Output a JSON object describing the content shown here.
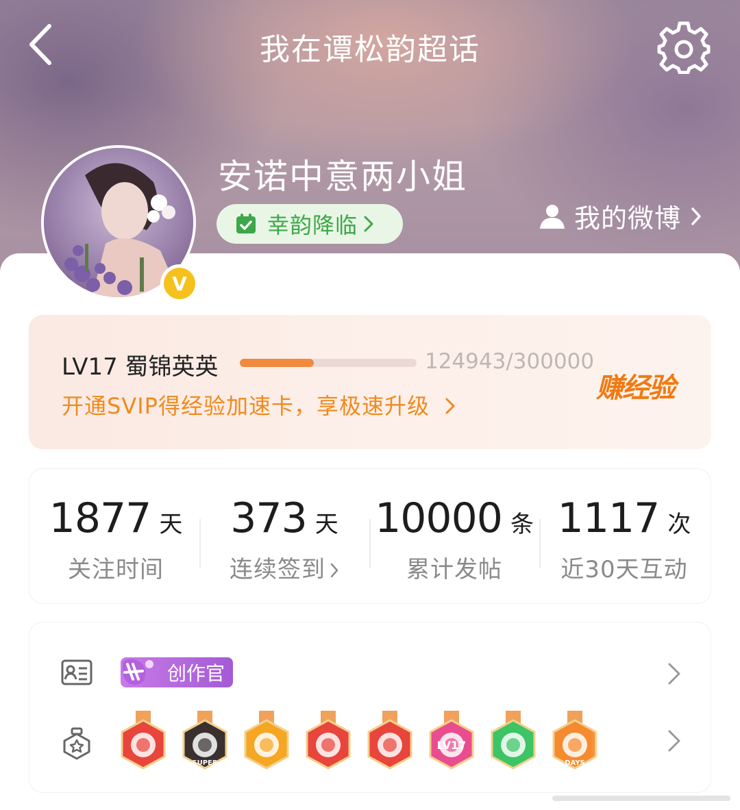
{
  "header": {
    "title": "我在谭松韵超话",
    "back_icon": "chevron-left-icon",
    "settings_icon": "gear-icon"
  },
  "profile": {
    "username": "安诺中意两小姐",
    "verified_badge": "V",
    "fortune_label": "幸韵降临",
    "fortune_icon": "calendar-check-icon",
    "my_weibo_label": "我的微博",
    "my_weibo_icon": "person-icon"
  },
  "level": {
    "name": "LV17 蜀锦英英",
    "progress": 0.42,
    "exp_text": "124943/300000",
    "promo_text": "开通SVIP得经验加速卡，享极速升级",
    "earn_label": "赚经验"
  },
  "stats": [
    {
      "value": "1877",
      "unit": "天",
      "label": "关注时间"
    },
    {
      "value": "373",
      "unit": "天",
      "label": "连续签到"
    },
    {
      "value": "10000",
      "unit": "条",
      "label": "累计发帖"
    },
    {
      "value": "1117",
      "unit": "次",
      "label": "近30天互动"
    }
  ],
  "badges": {
    "id_row_icon": "id-card-icon",
    "creator_tag": "创作官",
    "medal_row_icon": "medal-icon",
    "medals": [
      {
        "name": "dragon-medal",
        "color": "#e8453c",
        "text": ""
      },
      {
        "name": "super-crown-medal",
        "color": "#3a3030",
        "text": "SUPER"
      },
      {
        "name": "crown-medal",
        "color": "#f5a623",
        "text": ""
      },
      {
        "name": "cat-medal",
        "color": "#e8453c",
        "text": ""
      },
      {
        "name": "dragon2-medal",
        "color": "#e8453c",
        "text": ""
      },
      {
        "name": "lv17-medal",
        "color": "#e94d8f",
        "text": "LV17"
      },
      {
        "name": "hand-medal",
        "color": "#3cc465",
        "text": ""
      },
      {
        "name": "100-days-medal",
        "color": "#f58a2e",
        "text": "DAYS"
      }
    ]
  },
  "colors": {
    "accent_orange": "#f08a3e",
    "promo_orange": "#f08a1c",
    "green": "#3ea74a"
  }
}
